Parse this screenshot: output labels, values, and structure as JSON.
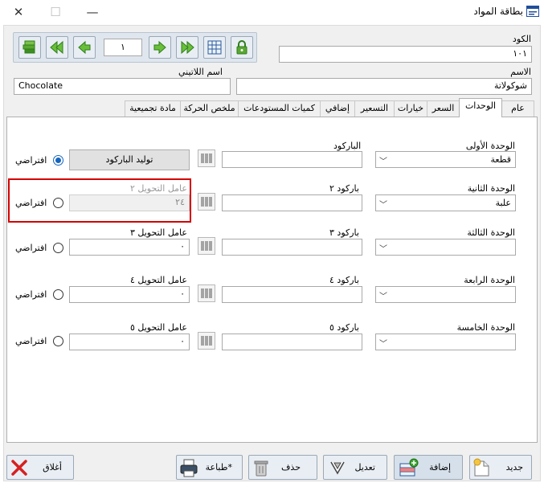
{
  "window": {
    "title": "بطاقة المواد"
  },
  "header": {
    "code_label": "الكود",
    "code_value": "١٠١",
    "name_label": "الاسم",
    "name_value": "شوكولاتة",
    "latin_label": "اسم اللاتيني",
    "latin_value": "Chocolate"
  },
  "nav": {
    "page": "١"
  },
  "tabs": [
    "عام",
    "الوحدات",
    "السعر",
    "خيارات",
    "التسعير",
    "إضافي",
    "كميات المستودعات",
    "ملخص الحركة",
    "مادة تجميعية"
  ],
  "units": {
    "rows": [
      {
        "unit_label": "الوحدة الأولى",
        "unit_value": "قطعة",
        "barcode_label": "الباركود",
        "default_label": "افتراضي"
      },
      {
        "unit_label": "الوحدة الثانية",
        "unit_value": "علبة",
        "barcode_label": "باركود ٢",
        "factor_label": "عامل التحويل ٢",
        "factor_value": "٢٤",
        "default_label": "افتراضي"
      },
      {
        "unit_label": "الوحدة الثالثة",
        "unit_value": "",
        "barcode_label": "باركود ٣",
        "factor_label": "عامل التحويل ٣",
        "factor_value": "٠",
        "default_label": "افتراضي"
      },
      {
        "unit_label": "الوحدة الرابعة",
        "unit_value": "",
        "barcode_label": "باركود ٤",
        "factor_label": "عامل التحويل ٤",
        "factor_value": "٠",
        "default_label": "افتراضي"
      },
      {
        "unit_label": "الوحدة الخامسة",
        "unit_value": "",
        "barcode_label": "باركود ٥",
        "factor_label": "عامل التحويل ٥",
        "factor_value": "٠",
        "default_label": "افتراضي"
      }
    ],
    "generate_barcode_label": "توليد الباركود"
  },
  "footer": {
    "new_label": "جديد",
    "add_label": "إضافة",
    "edit_label": "تعديل",
    "delete_label": "حذف",
    "print_label": "طباعة*",
    "close_label": "أغلاق"
  }
}
